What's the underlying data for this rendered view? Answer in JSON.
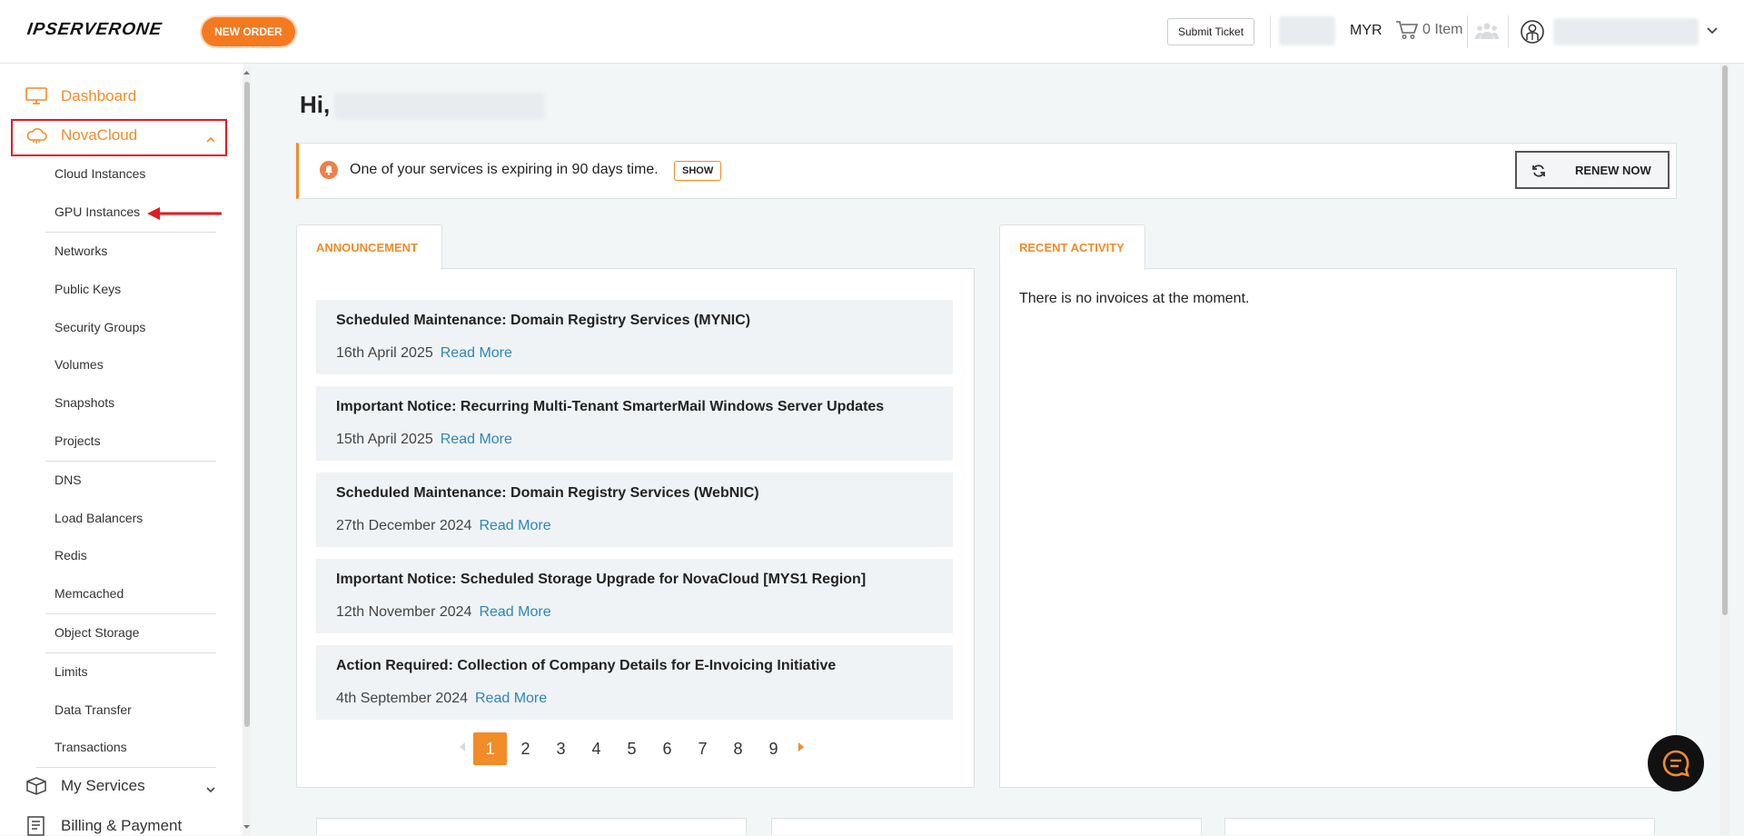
{
  "header": {
    "logo_text": "IPSERVERONE",
    "new_order_label": "NEW ORDER",
    "submit_ticket_label": "Submit Ticket",
    "currency": "MYR",
    "cart_label": "0 Item"
  },
  "sidebar": {
    "dashboard_label": "Dashboard",
    "novacloud_label": "NovaCloud",
    "sub_items": [
      "Cloud Instances",
      "GPU Instances",
      "Networks",
      "Public Keys",
      "Security Groups",
      "Volumes",
      "Snapshots",
      "Projects",
      "DNS",
      "Load Balancers",
      "Redis",
      "Memcached",
      "Object Storage",
      "Limits",
      "Data Transfer",
      "Transactions"
    ],
    "my_services_label": "My Services",
    "billing_label": "Billing & Payment"
  },
  "main": {
    "greeting": "Hi,",
    "alert": {
      "text": "One of your services is expiring in 90 days time.",
      "show_label": "SHOW",
      "renew_label": "RENEW NOW"
    },
    "announcement_tab": "ANNOUNCEMENT",
    "announcements": [
      {
        "title": "Scheduled Maintenance: Domain Registry Services (MYNIC)",
        "date": "16th April 2025",
        "link": "Read More"
      },
      {
        "title": "Important Notice: Recurring Multi-Tenant SmarterMail Windows Server Updates",
        "date": "15th April 2025",
        "link": "Read More"
      },
      {
        "title": "Scheduled Maintenance: Domain Registry Services (WebNIC)",
        "date": "27th December 2024",
        "link": "Read More"
      },
      {
        "title": "Important Notice: Scheduled Storage Upgrade for NovaCloud [MYS1 Region]",
        "date": "12th November 2024",
        "link": "Read More"
      },
      {
        "title": "Action Required: Collection of Company Details for E-Invoicing Initiative",
        "date": "4th September 2024",
        "link": "Read More"
      }
    ],
    "pagination": {
      "pages": [
        "1",
        "2",
        "3",
        "4",
        "5",
        "6",
        "7",
        "8",
        "9"
      ],
      "current": "1"
    },
    "recent_activity_tab": "RECENT ACTIVITY",
    "no_invoices_text": "There is no invoices at the moment."
  },
  "colors": {
    "accent": "#f28c28",
    "link": "#2b87b8",
    "highlight": "#e11b22"
  },
  "icons": [
    "monitor-icon",
    "cloud-icon",
    "chevron-up-icon",
    "chevron-down-icon",
    "cart-icon",
    "people-icon",
    "user-icon",
    "bell-icon",
    "refresh-icon",
    "chat-icon",
    "box-icon",
    "billing-icon",
    "arrow-left-icon"
  ]
}
